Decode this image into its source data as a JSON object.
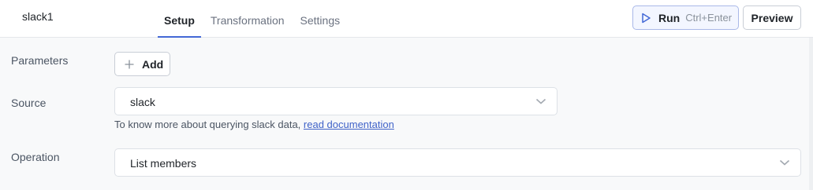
{
  "header": {
    "query_name": "slack1",
    "tabs": [
      {
        "label": "Setup",
        "active": true
      },
      {
        "label": "Transformation",
        "active": false
      },
      {
        "label": "Settings",
        "active": false
      }
    ],
    "run": {
      "label": "Run",
      "shortcut": "Ctrl+Enter",
      "icon": "play-icon"
    },
    "preview_label": "Preview"
  },
  "form": {
    "parameters": {
      "label": "Parameters",
      "add_label": "Add",
      "add_icon": "plus-icon"
    },
    "source": {
      "label": "Source",
      "value": "slack",
      "hint_text": "To know more about querying slack data, ",
      "hint_link": "read documentation"
    },
    "operation": {
      "label": "Operation",
      "value": "List members"
    }
  },
  "colors": {
    "accent": "#4368d6",
    "link": "#3f62c8",
    "background": "#f8f9fa"
  }
}
